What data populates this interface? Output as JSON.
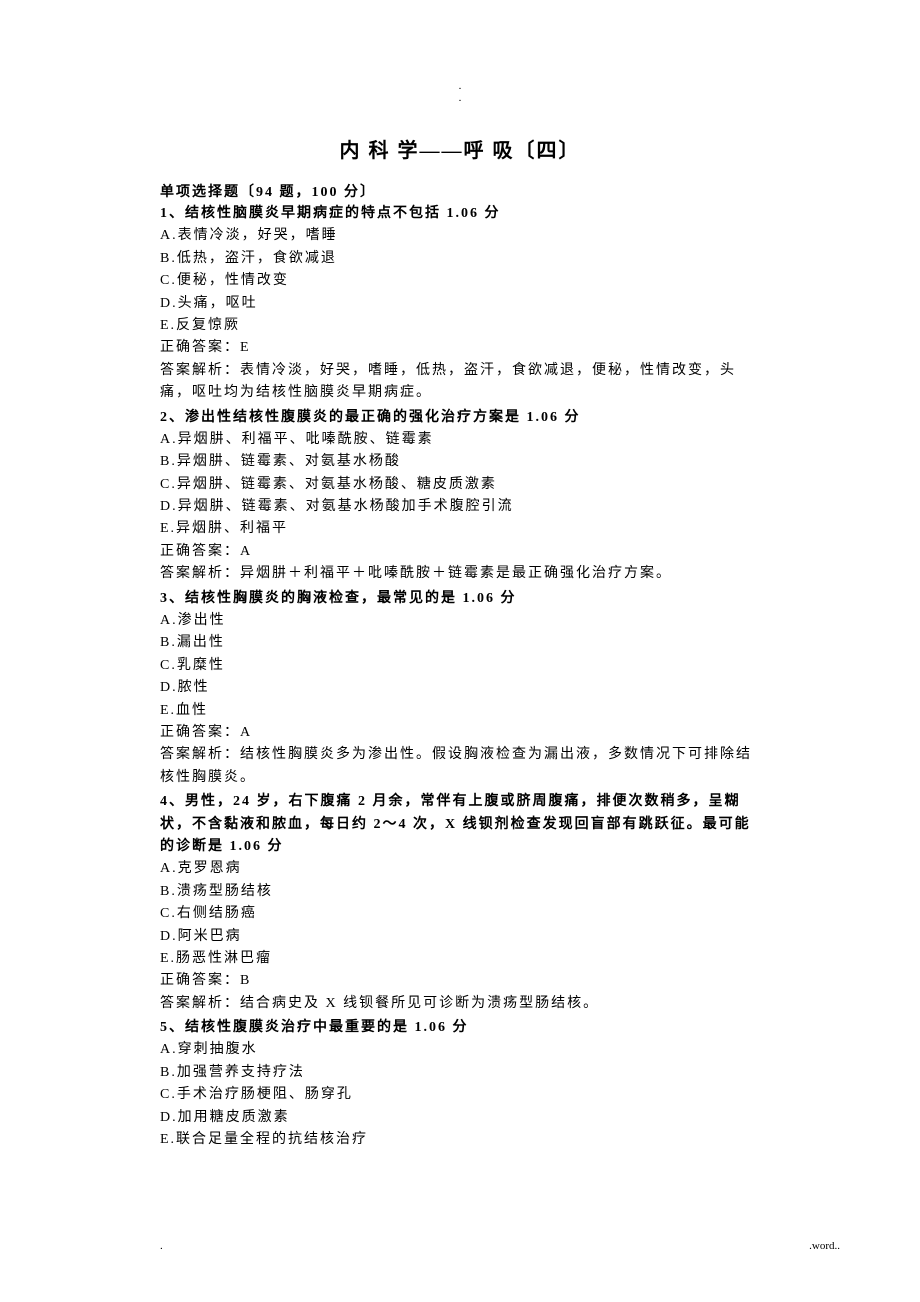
{
  "header_period": ".",
  "header_period2": ".",
  "title": "内 科 学——呼 吸〔四〕",
  "section_header": "单项选择题〔94 题，100 分〕",
  "questions": [
    {
      "q": "1、结核性脑膜炎早期病症的特点不包括 1.06 分",
      "options": [
        "A.表情冷淡，好哭，嗜睡",
        "B.低热，盗汗，食欲减退",
        "C.便秘，性情改变",
        "D.头痛，呕吐",
        "E.反复惊厥"
      ],
      "answer": "正确答案：E",
      "explanation": "答案解析：表情冷淡，好哭，嗜睡，低热，盗汗，食欲减退，便秘，性情改变，头痛，呕吐均为结核性脑膜炎早期病症。"
    },
    {
      "q": "2、渗出性结核性腹膜炎的最正确的强化治疗方案是 1.06 分",
      "options": [
        "A.异烟肼、利福平、吡嗪酰胺、链霉素",
        "B.异烟肼、链霉素、对氨基水杨酸",
        "C.异烟肼、链霉素、对氨基水杨酸、糖皮质激素",
        "D.异烟肼、链霉素、对氨基水杨酸加手术腹腔引流",
        "E.异烟肼、利福平"
      ],
      "answer": "正确答案：A",
      "explanation": "答案解析：异烟肼＋利福平＋吡嗪酰胺＋链霉素是最正确强化治疗方案。"
    },
    {
      "q": "3、结核性胸膜炎的胸液检查，最常见的是 1.06 分",
      "options": [
        "A.渗出性",
        "B.漏出性",
        "C.乳糜性",
        "D.脓性",
        "E.血性"
      ],
      "answer": "正确答案：A",
      "explanation": "答案解析：结核性胸膜炎多为渗出性。假设胸液检查为漏出液，多数情况下可排除结核性胸膜炎。"
    },
    {
      "q": "4、男性，24 岁，右下腹痛 2 月余，常伴有上腹或脐周腹痛，排便次数稍多，呈糊状，不含黏液和脓血，每日约 2～4 次，X 线钡剂检查发现回盲部有跳跃征。最可能的诊断是 1.06 分",
      "options": [
        "A.克罗恩病",
        "B.溃疡型肠结核",
        "C.右侧结肠癌",
        "D.阿米巴病",
        "E.肠恶性淋巴瘤"
      ],
      "answer": "正确答案：B",
      "explanation": "答案解析：结合病史及 X 线钡餐所见可诊断为溃疡型肠结核。"
    },
    {
      "q": "5、结核性腹膜炎治疗中最重要的是 1.06 分",
      "options": [
        "A.穿刺抽腹水",
        "B.加强营养支持疗法",
        "C.手术治疗肠梗阻、肠穿孔",
        "D.加用糖皮质激素",
        "E.联合足量全程的抗结核治疗"
      ],
      "answer": "",
      "explanation": ""
    }
  ],
  "footer_left": ".",
  "footer_right": ".word.."
}
